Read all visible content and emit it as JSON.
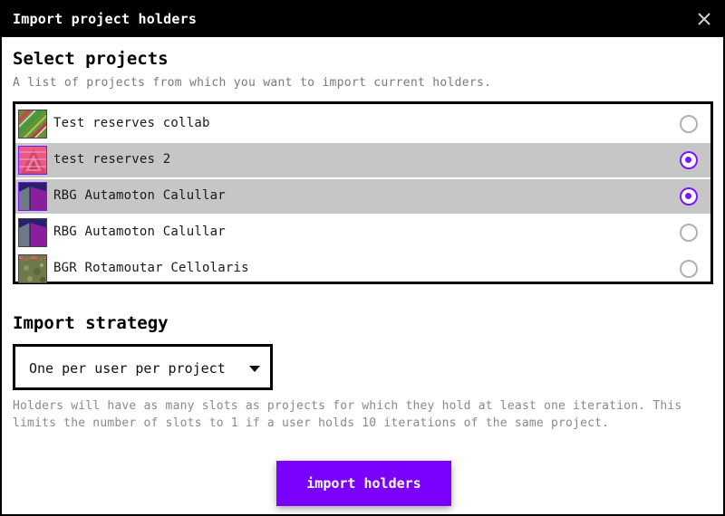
{
  "dialog": {
    "title": "Import project holders",
    "close_icon": "close-icon"
  },
  "select_projects": {
    "heading": "Select projects",
    "subtitle": "A list of projects from which you want to import current holders.",
    "projects": [
      {
        "name": "Test reserves collab",
        "selected": false,
        "thumb": "green-red-pattern"
      },
      {
        "name": "test reserves 2",
        "selected": true,
        "thumb": "pink-triangles"
      },
      {
        "name": "RBG Autamoton Calullar",
        "selected": true,
        "thumb": "purple-cube"
      },
      {
        "name": "RBG Autamoton Calullar",
        "selected": false,
        "thumb": "purple-cube"
      },
      {
        "name": "BGR Rotamoutar Cellolaris",
        "selected": false,
        "thumb": "green-texture"
      }
    ]
  },
  "import_strategy": {
    "heading": "Import strategy",
    "selected_option": "One per user per project",
    "description": "Holders will have as many slots as projects for which they hold at least one iteration. This limits the number of slots to 1 if a user holds 10 iterations of the same project."
  },
  "actions": {
    "import_label": "import holders"
  },
  "colors": {
    "accent": "#7a00ff",
    "radio_checked": "#7a19ff",
    "selected_row": "#c6c6c6"
  }
}
